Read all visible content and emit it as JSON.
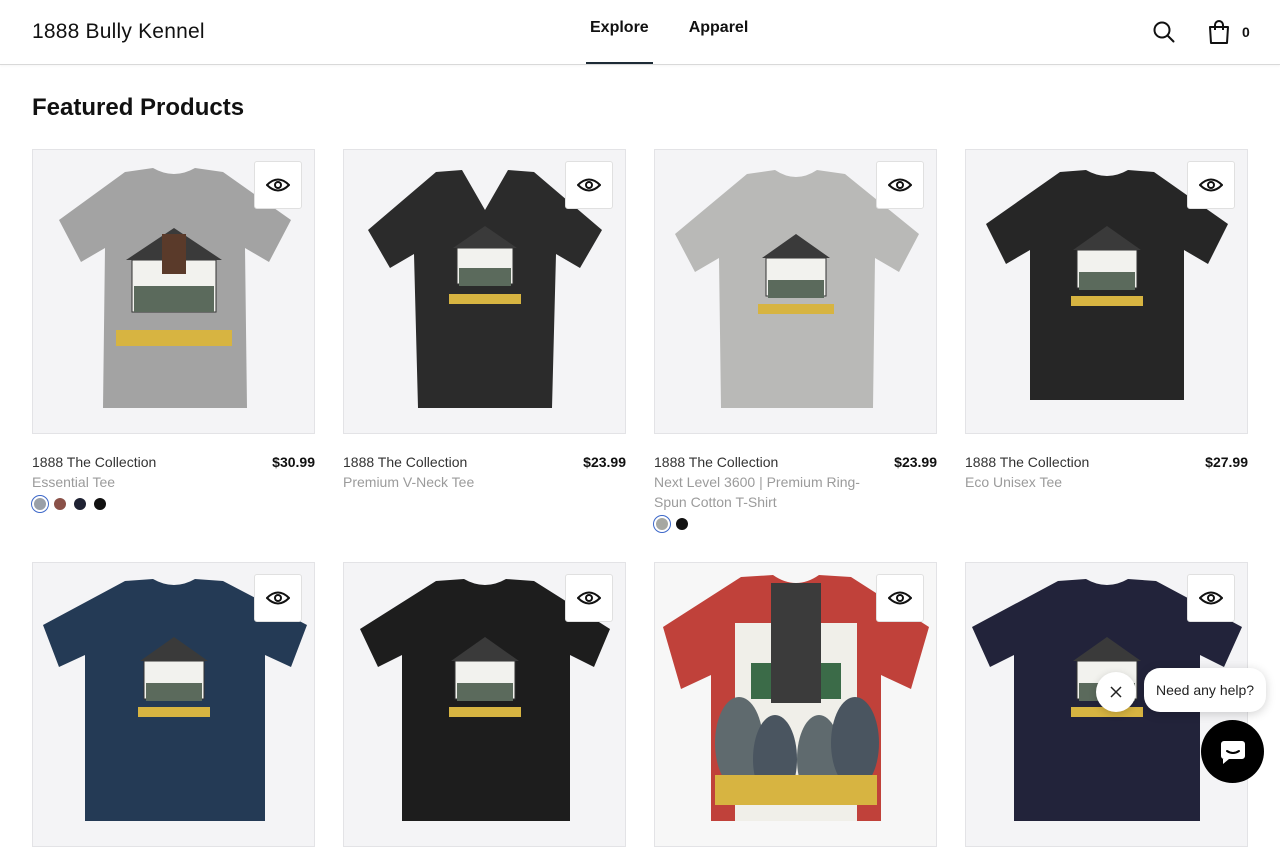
{
  "header": {
    "brand": "1888 Bully Kennel",
    "nav": [
      {
        "label": "Explore"
      },
      {
        "label": "Apparel"
      }
    ],
    "cart_count": "0"
  },
  "main": {
    "section_title": "Featured Products",
    "products": [
      {
        "collection": "1888 The Collection",
        "type": "Essential Tee",
        "price": "$30.99",
        "shirt_color": "#a3a3a3"
      },
      {
        "collection": "1888 The Collection",
        "type": "Premium V-Neck Tee",
        "price": "$23.99",
        "shirt_color": "#2b2b2b"
      },
      {
        "collection": "1888 The Collection",
        "type": "Next Level 3600 | Premium Ring-Spun Cotton T-Shirt",
        "price": "$23.99",
        "shirt_color": "#b9b9b7"
      },
      {
        "collection": "1888 The Collection",
        "type": "Eco Unisex Tee",
        "price": "$27.99",
        "shirt_color": "#262626"
      },
      {
        "shirt_color": "#243a55"
      },
      {
        "shirt_color": "#1d1d1d"
      },
      {
        "shirt_color": "#c0413a"
      },
      {
        "shirt_color": "#22233a"
      }
    ],
    "swatches_p1": [
      "#9aa0a8",
      "#8a5148",
      "#1f2233",
      "#111111"
    ],
    "swatches_p3": [
      "#a6a8a2",
      "#111111"
    ]
  },
  "chat": {
    "prompt": "Need any help?"
  },
  "icons": {
    "search": "search-icon",
    "cart": "shopping-bag-icon",
    "quick_view": "eye-icon",
    "chat": "chat-icon",
    "close": "close-icon"
  }
}
